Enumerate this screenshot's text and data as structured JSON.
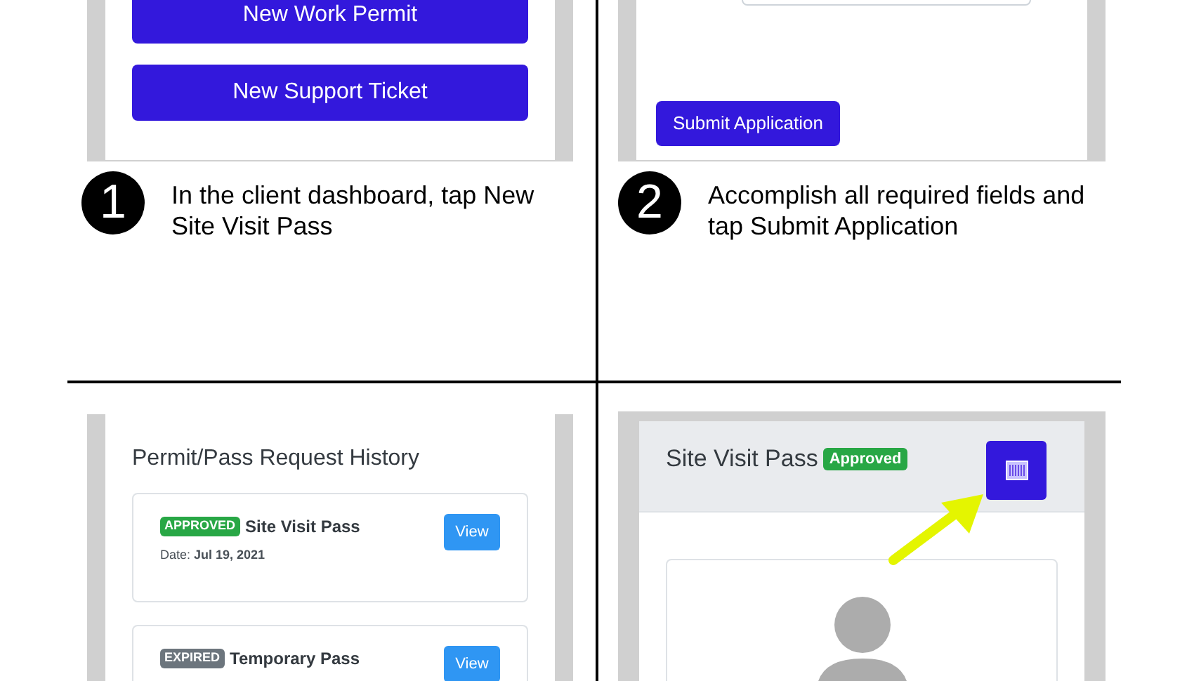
{
  "dashboard": {
    "buttons": [
      "New Work Permit",
      "New Support Ticket"
    ]
  },
  "application_form": {
    "submit_button": "Submit Application"
  },
  "steps": [
    {
      "number": "1",
      "text": "In the client dashboard, tap New Site Visit Pass"
    },
    {
      "number": "2",
      "text": "Accomplish all required fields and tap Submit Application"
    }
  ],
  "history": {
    "title": "Permit/Pass Request History",
    "requests": [
      {
        "status": "APPROVED",
        "color": "#28a745",
        "name": "Site Visit Pass",
        "date": "Date: **Jul 19, 2021**",
        "button": "View"
      },
      {
        "status": "EXPIRED",
        "color": "#6c757d",
        "name": "Temporary Pass",
        "button": "View"
      }
    ]
  },
  "pass": {
    "title": "Site Visit Pass",
    "badge": "Approved"
  }
}
